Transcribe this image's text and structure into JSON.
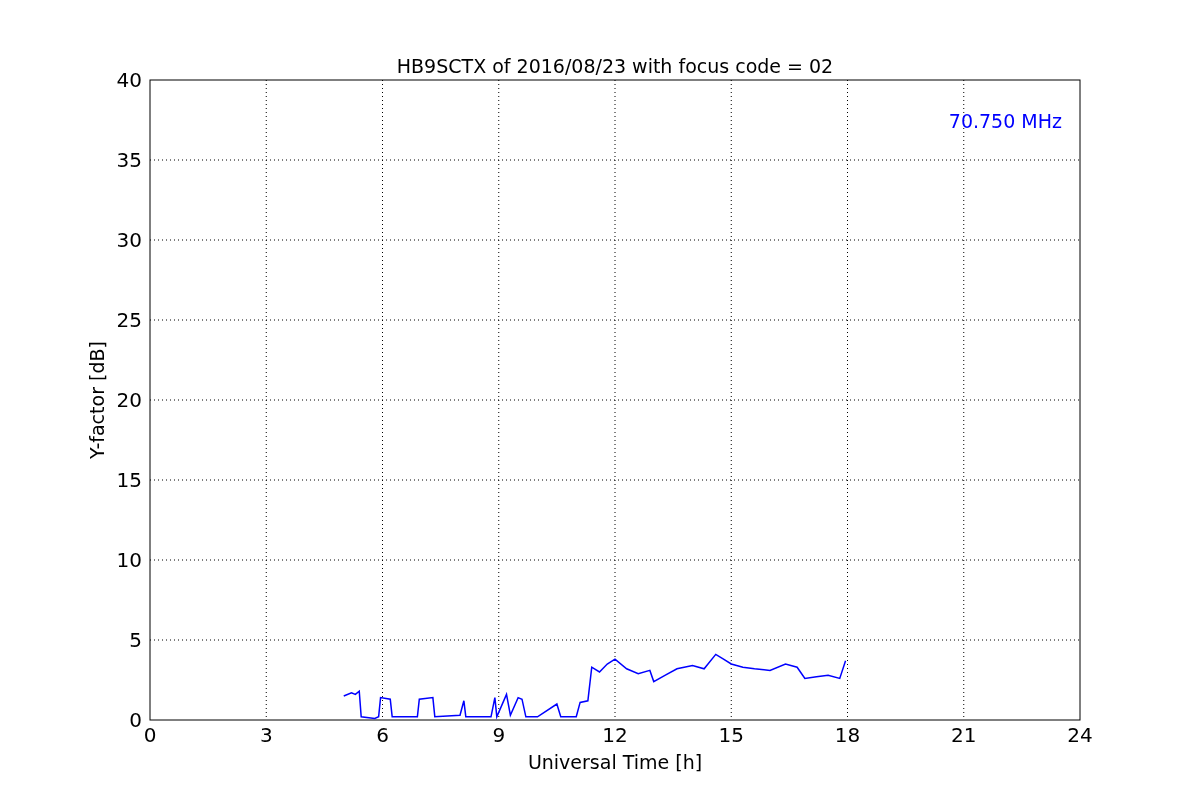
{
  "chart_data": {
    "type": "line",
    "title": "HB9SCTX of 2016/08/23 with focus code = 02",
    "xlabel": "Universal Time [h]",
    "ylabel": "Y-factor [dB]",
    "xlim": [
      0,
      24
    ],
    "ylim": [
      0,
      40
    ],
    "xticks": [
      0,
      3,
      6,
      9,
      12,
      15,
      18,
      21,
      24
    ],
    "yticks": [
      0,
      5,
      10,
      15,
      20,
      25,
      30,
      35,
      40
    ],
    "series": [
      {
        "name": "70.750 MHz",
        "color": "#0000ff",
        "x": [
          5.0,
          5.2,
          5.3,
          5.4,
          5.45,
          5.8,
          5.9,
          5.95,
          6.2,
          6.25,
          6.9,
          6.95,
          7.3,
          7.35,
          8.0,
          8.1,
          8.15,
          8.8,
          8.9,
          8.95,
          9.2,
          9.3,
          9.5,
          9.6,
          9.7,
          10.0,
          10.5,
          10.6,
          11.0,
          11.1,
          11.3,
          11.4,
          11.6,
          11.8,
          12.0,
          12.3,
          12.6,
          12.9,
          13.0,
          13.3,
          13.6,
          14.0,
          14.3,
          14.6,
          14.8,
          15.0,
          15.3,
          15.6,
          16.0,
          16.4,
          16.7,
          16.9,
          17.2,
          17.5,
          17.8,
          17.95
        ],
        "values": [
          1.5,
          1.7,
          1.6,
          1.8,
          0.2,
          0.1,
          0.2,
          1.4,
          1.3,
          0.2,
          0.2,
          1.3,
          1.4,
          0.2,
          0.3,
          1.2,
          0.2,
          0.2,
          1.4,
          0.2,
          1.6,
          0.3,
          1.4,
          1.3,
          0.2,
          0.2,
          1.0,
          0.2,
          0.2,
          1.1,
          1.2,
          3.3,
          3.0,
          3.5,
          3.8,
          3.2,
          2.9,
          3.1,
          2.4,
          2.8,
          3.2,
          3.4,
          3.2,
          4.1,
          3.8,
          3.5,
          3.3,
          3.2,
          3.1,
          3.5,
          3.3,
          2.6,
          2.7,
          2.8,
          2.6,
          3.7
        ]
      }
    ],
    "grid": true
  }
}
